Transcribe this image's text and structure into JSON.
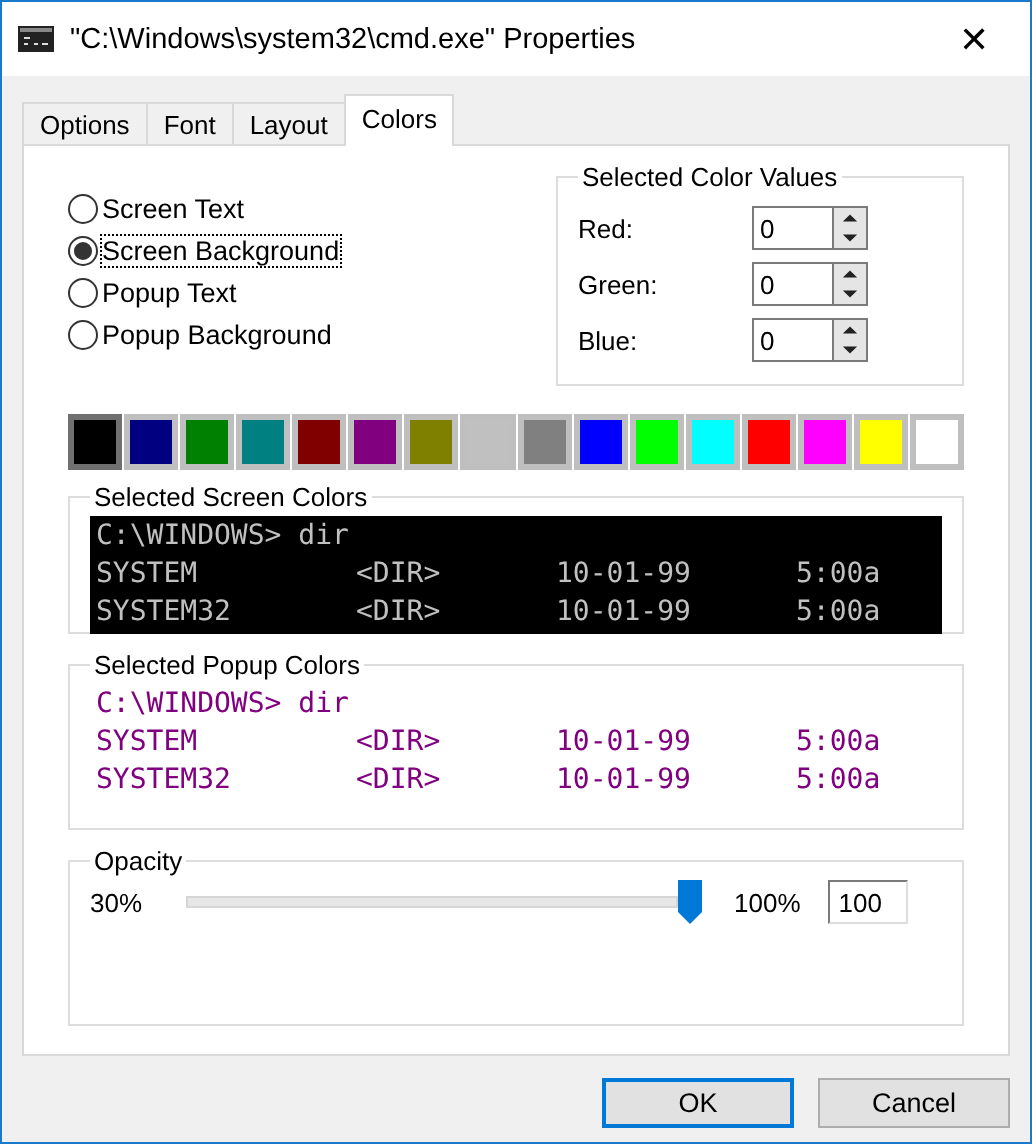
{
  "window": {
    "title": "\"C:\\Windows\\system32\\cmd.exe\" Properties",
    "close": "✕"
  },
  "tabs": [
    {
      "label": "Options",
      "selected": false
    },
    {
      "label": "Font",
      "selected": false
    },
    {
      "label": "Layout",
      "selected": false
    },
    {
      "label": "Colors",
      "selected": true
    }
  ],
  "targets": [
    {
      "label": "Screen Text",
      "selected": false
    },
    {
      "label": "Screen Background",
      "selected": true
    },
    {
      "label": "Popup Text",
      "selected": false
    },
    {
      "label": "Popup Background",
      "selected": false
    }
  ],
  "color_values": {
    "title": "Selected Color Values",
    "fields": [
      {
        "label": "Red:",
        "value": "0"
      },
      {
        "label": "Green:",
        "value": "0"
      },
      {
        "label": "Blue:",
        "value": "0"
      }
    ]
  },
  "palette": [
    {
      "color": "#000000",
      "selected": true
    },
    {
      "color": "#000080",
      "selected": false
    },
    {
      "color": "#008000",
      "selected": false
    },
    {
      "color": "#008080",
      "selected": false
    },
    {
      "color": "#800000",
      "selected": false
    },
    {
      "color": "#800080",
      "selected": false
    },
    {
      "color": "#808000",
      "selected": false
    },
    {
      "color": "#c0c0c0",
      "selected": false
    },
    {
      "color": "#808080",
      "selected": false
    },
    {
      "color": "#0000ff",
      "selected": false
    },
    {
      "color": "#00ff00",
      "selected": false
    },
    {
      "color": "#00ffff",
      "selected": false
    },
    {
      "color": "#ff0000",
      "selected": false
    },
    {
      "color": "#ff00ff",
      "selected": false
    },
    {
      "color": "#ffff00",
      "selected": false
    },
    {
      "color": "#ffffff",
      "selected": false
    }
  ],
  "previews": [
    {
      "title": "Selected Screen Colors",
      "kind": "screen",
      "prompt": "C:\\WINDOWS> dir",
      "rows": [
        [
          "SYSTEM",
          "<DIR>",
          "10-01-99",
          "5:00a"
        ],
        [
          "SYSTEM32",
          "<DIR>",
          "10-01-99",
          "5:00a"
        ]
      ]
    },
    {
      "title": "Selected Popup Colors",
      "kind": "popup",
      "prompt": "C:\\WINDOWS> dir",
      "rows": [
        [
          "SYSTEM",
          "<DIR>",
          "10-01-99",
          "5:00a"
        ],
        [
          "SYSTEM32",
          "<DIR>",
          "10-01-99",
          "5:00a"
        ]
      ]
    }
  ],
  "opacity": {
    "title": "Opacity",
    "min_label": "30%",
    "max_label": "100%",
    "level": 1,
    "value": "100"
  },
  "buttons": [
    {
      "label": "OK",
      "default": true
    },
    {
      "label": "Cancel",
      "default": false
    }
  ]
}
